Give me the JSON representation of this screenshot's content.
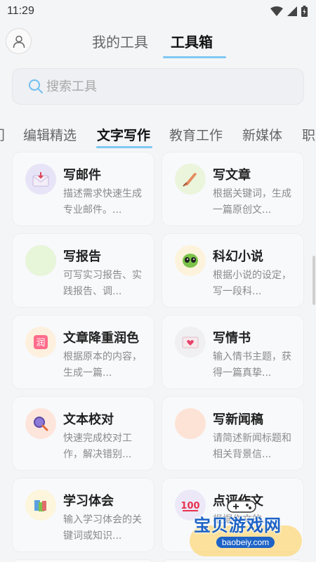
{
  "status_bar": {
    "time": "11:29"
  },
  "header": {
    "tabs": [
      {
        "label": "我的工具",
        "active": false
      },
      {
        "label": "工具箱",
        "active": true
      }
    ]
  },
  "search": {
    "placeholder": "搜索工具"
  },
  "categories": [
    {
      "label": "门",
      "active": false
    },
    {
      "label": "编辑精选",
      "active": false
    },
    {
      "label": "文字写作",
      "active": true
    },
    {
      "label": "教育工作",
      "active": false
    },
    {
      "label": "新媒体",
      "active": false
    },
    {
      "label": "职",
      "active": false
    }
  ],
  "tools": [
    {
      "title": "写邮件",
      "desc": "描述需求快速生成专业邮件。...",
      "icon": "mail-icon",
      "icon_bg": "#e8e4f7"
    },
    {
      "title": "写文章",
      "desc": "根据关键词，生成一篇原创文...",
      "icon": "pen-icon",
      "icon_bg": "#eaf5dc"
    },
    {
      "title": "写报告",
      "desc": "可写实习报告、实践报告、调...",
      "icon": "report-icon",
      "icon_bg": "#e7f5d9"
    },
    {
      "title": "科幻小说",
      "desc": "根据小说的设定，写一段科...",
      "icon": "alien-icon",
      "icon_bg": "#fdf3dc"
    },
    {
      "title": "文章降重润色",
      "desc": "根据原本的内容，生成一篇...",
      "icon": "polish-icon",
      "icon_bg": "#fdf0de"
    },
    {
      "title": "写情书",
      "desc": "输入情书主题，获得一篇真挚...",
      "icon": "love-letter-icon",
      "icon_bg": "#f0f0f2"
    },
    {
      "title": "文本校对",
      "desc": "快速完成校对工作，解决错别...",
      "icon": "magnifier-icon",
      "icon_bg": "#fde5dc"
    },
    {
      "title": "写新闻稿",
      "desc": "请简述新闻标题和相关背景信...",
      "icon": "news-icon",
      "icon_bg": "#fde3d6"
    },
    {
      "title": "学习体会",
      "desc": "输入学习体会的关键词或知识...",
      "icon": "books-icon",
      "icon_bg": "#fdf5dc"
    },
    {
      "title": "点评作文",
      "desc": "根据作文的...",
      "icon": "score-100-icon",
      "icon_bg": "#ece8f8"
    }
  ],
  "watermark": {
    "text": "宝贝游戏网",
    "url": "baobeiy.com"
  },
  "colors": {
    "accent": "#7fc8f3",
    "background": "#f4f5f7",
    "card": "#f8f9fb"
  }
}
